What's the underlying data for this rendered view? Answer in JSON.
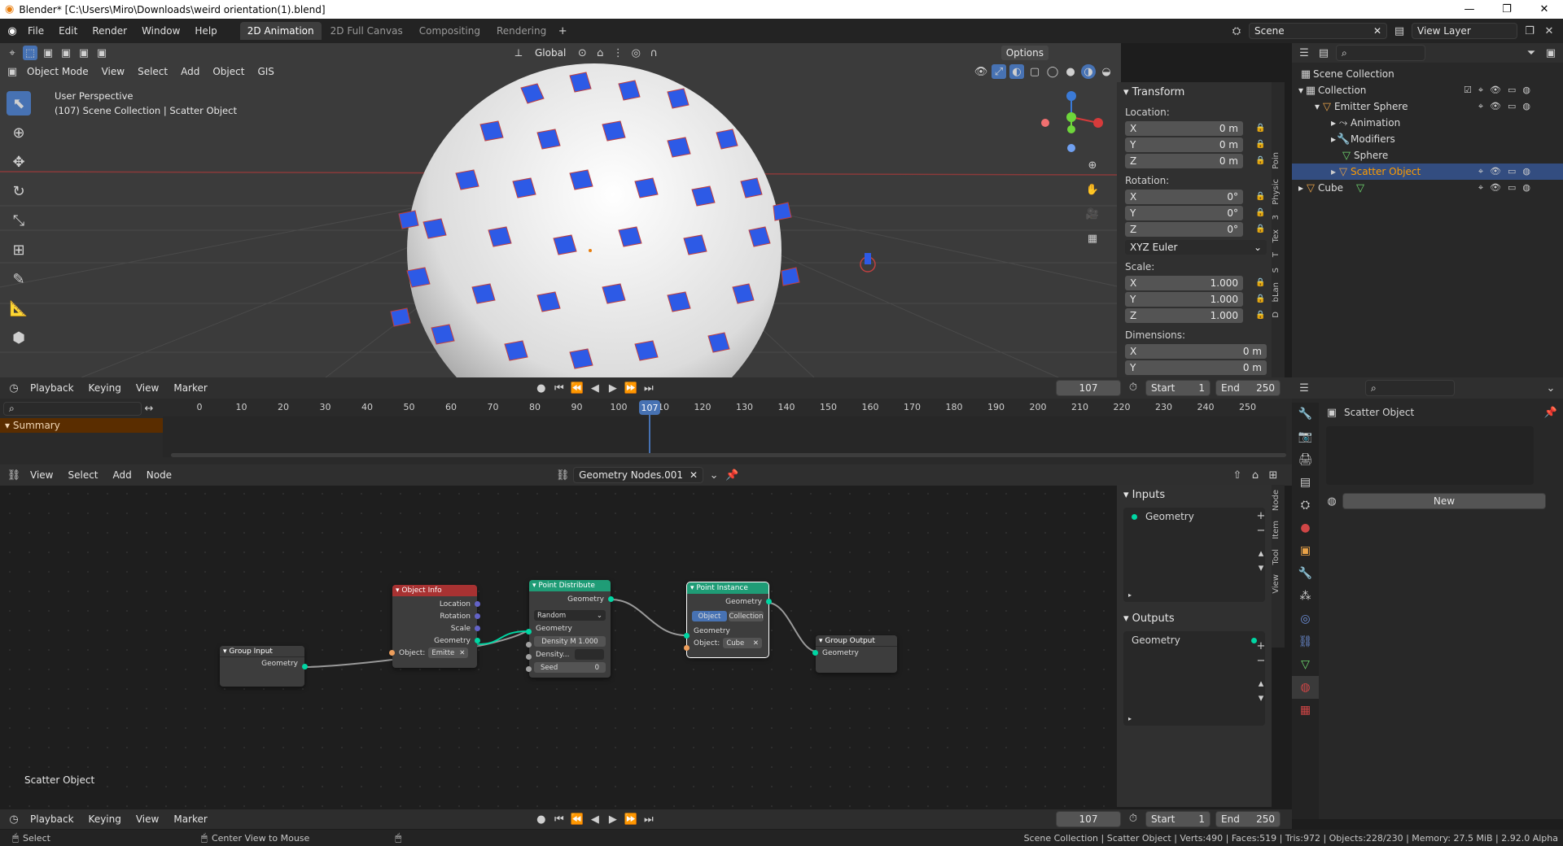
{
  "window": {
    "title": "Blender* [C:\\Users\\Miro\\Downloads\\weird orientation(1).blend]"
  },
  "menu": [
    "File",
    "Edit",
    "Render",
    "Window",
    "Help"
  ],
  "workspaces": [
    "2D Animation",
    "2D Full Canvas",
    "Compositing",
    "Rendering"
  ],
  "active_workspace": 0,
  "scene": {
    "name": "Scene",
    "view_layer": "View Layer"
  },
  "viewport": {
    "mode": "Object Mode",
    "menus": [
      "View",
      "Select",
      "Add",
      "Object",
      "GIS"
    ],
    "transform_orientation": "Global",
    "options_label": "Options",
    "overlay_line1": "User Perspective",
    "overlay_line2": "(107) Scene Collection | Scatter Object"
  },
  "npanel": {
    "title": "Transform",
    "location_label": "Location:",
    "location": [
      {
        "axis": "X",
        "value": "0 m"
      },
      {
        "axis": "Y",
        "value": "0 m"
      },
      {
        "axis": "Z",
        "value": "0 m"
      }
    ],
    "rotation_label": "Rotation:",
    "rotation": [
      {
        "axis": "X",
        "value": "0°"
      },
      {
        "axis": "Y",
        "value": "0°"
      },
      {
        "axis": "Z",
        "value": "0°"
      }
    ],
    "rotation_mode": "XYZ Euler",
    "scale_label": "Scale:",
    "scale": [
      {
        "axis": "X",
        "value": "1.000"
      },
      {
        "axis": "Y",
        "value": "1.000"
      },
      {
        "axis": "Z",
        "value": "1.000"
      }
    ],
    "dimensions_label": "Dimensions:",
    "dimensions": [
      {
        "axis": "X",
        "value": "0 m"
      },
      {
        "axis": "Y",
        "value": "0 m"
      }
    ],
    "tabs": [
      "Poin",
      "Physic",
      "3",
      "Tex",
      "T",
      "S",
      "bLan",
      "D"
    ]
  },
  "outliner": {
    "rows": [
      {
        "label": "Scene Collection",
        "indent": 0
      },
      {
        "label": "Collection",
        "indent": 1
      },
      {
        "label": "Emitter Sphere",
        "indent": 2
      },
      {
        "label": "Animation",
        "indent": 3
      },
      {
        "label": "Modifiers",
        "indent": 3
      },
      {
        "label": "Sphere",
        "indent": 3
      },
      {
        "label": "Scatter Object",
        "indent": 3,
        "selected": true
      },
      {
        "label": "Cube",
        "indent": 1
      }
    ]
  },
  "timeline": {
    "menus": [
      "Playback",
      "Keying",
      "View",
      "Marker"
    ],
    "current_frame": "107",
    "start_label": "Start",
    "start": "1",
    "end_label": "End",
    "end": "250",
    "ticks": [
      "0",
      "10",
      "20",
      "30",
      "40",
      "50",
      "60",
      "70",
      "80",
      "90",
      "100",
      "110",
      "120",
      "130",
      "140",
      "150",
      "160",
      "170",
      "180",
      "190",
      "200",
      "210",
      "220",
      "230",
      "240",
      "250"
    ],
    "summary_label": "Summary"
  },
  "node_editor": {
    "menus": [
      "View",
      "Select",
      "Add",
      "Node"
    ],
    "node_tree": "Geometry Nodes.001",
    "object_label": "Scatter Object",
    "nodes": {
      "group_input": {
        "title": "Group Input",
        "out": "Geometry"
      },
      "object_info": {
        "title": "Object Info",
        "outs": [
          "Location",
          "Rotation",
          "Scale",
          "Geometry"
        ],
        "object_label": "Object:",
        "object_value": "Emitte"
      },
      "point_distribute": {
        "title": "Point Distribute",
        "out": "Geometry",
        "mode": "Random",
        "in": "Geometry",
        "density_max": "Density M  1.000",
        "density": "Density...",
        "seed": "Seed",
        "seed_value": "0"
      },
      "point_instance": {
        "title": "Point Instance",
        "out": "Geometry",
        "opt1": "Object",
        "opt2": "Collection",
        "in": "Geometry",
        "object_label": "Object:",
        "object_value": "Cube"
      },
      "group_output": {
        "title": "Group Output",
        "in": "Geometry"
      }
    },
    "inputs_title": "Inputs",
    "inputs_item": "Geometry",
    "outputs_title": "Outputs",
    "outputs_item": "Geometry",
    "tabs": [
      "Node",
      "Item",
      "Tool",
      "View"
    ]
  },
  "properties": {
    "object_name": "Scatter Object",
    "new_label": "New"
  },
  "bottom_timeline": {
    "menus": [
      "Playback",
      "Keying",
      "View",
      "Marker"
    ],
    "current_frame": "107",
    "start_label": "Start",
    "start": "1",
    "end_label": "End",
    "end": "250"
  },
  "status": {
    "left1": "Select",
    "left2": "Center View to Mouse",
    "right": "Scene Collection | Scatter Object | Verts:490 | Faces:519 | Tris:972 | Objects:228/230 | Memory: 27.5 MiB | 2.92.0 Alpha"
  },
  "colors": {
    "accent": "#4772b3",
    "selection": "#ff9d00",
    "object_info": "#a83232",
    "point_node": "#1f9c76"
  }
}
